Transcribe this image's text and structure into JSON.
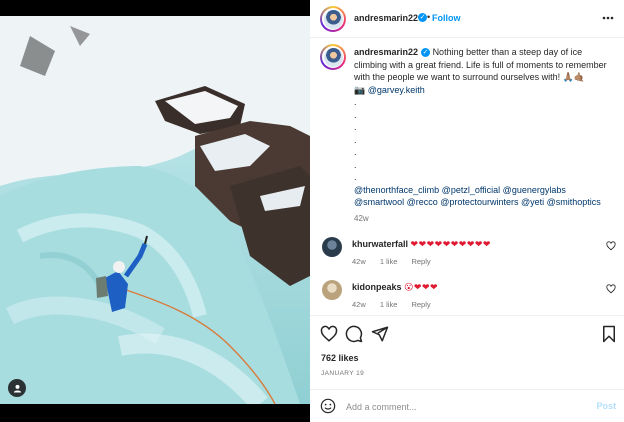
{
  "post": {
    "author": "andresmarin22",
    "follow_label": "Follow",
    "more_label": "More options",
    "caption": {
      "text": "Nothing better than a steep day of ice climbing with a great friend. Life is full of moments to remember with the people we want to surround ourselves with! 🙏🏽🤙🏽",
      "camera_emoji": "📷",
      "mention": "@garvey.keith",
      "dots": [
        ".",
        ".",
        ".",
        ".",
        ".",
        ".",
        "."
      ],
      "tags_line1": "@thenorthface_climb @petzl_official @guenergylabs",
      "tags_line2": "@smartwool @recco @protectourwinters @yeti @smithoptics",
      "time": "42w"
    }
  },
  "comments": [
    {
      "user": "khurwaterfall",
      "text": "❤❤❤❤❤❤❤❤❤❤",
      "time": "42w",
      "likes": "1 like",
      "reply": "Reply",
      "avatar_color": "#2a3b4c"
    },
    {
      "user": "kidonpeaks",
      "text": "😮❤❤❤",
      "time": "42w",
      "likes": "1 like",
      "reply": "Reply",
      "avatar_color": "#b9a27c"
    }
  ],
  "engagement": {
    "likes": "762 likes",
    "date": "JANUARY 19"
  },
  "comment_box": {
    "placeholder": "Add a comment...",
    "post_label": "Post"
  },
  "colors": {
    "accent": "#0095f6",
    "heart": "#e0182f",
    "link": "#00376b",
    "muted": "#737373"
  },
  "icons": [
    "verified-badge",
    "more-icon",
    "heart-icon",
    "comment-icon",
    "share-icon",
    "bookmark-icon",
    "emoji-icon",
    "user-tag-icon"
  ]
}
